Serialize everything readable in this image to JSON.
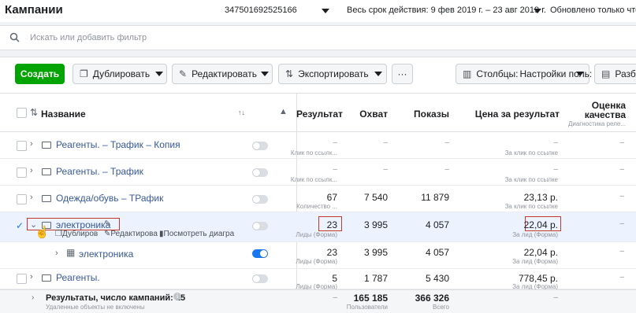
{
  "header": {
    "title": "Кампании",
    "account_id": "347501692525166",
    "date_range": "Весь срок действия: 9 фев 2019 г. – 23 авг 2019 г.",
    "updated": "Обновлено только что"
  },
  "search": {
    "placeholder": "Искать или добавить фильтр"
  },
  "toolbar": {
    "create": "Создать",
    "duplicate": "Дублировать",
    "edit": "Редактировать",
    "export": "Экспортировать",
    "more": "···",
    "columns_prefix": "Столбцы:",
    "columns_value": "Настройки поль:",
    "breakdown": "Разби"
  },
  "table": {
    "headers": {
      "name": "Название",
      "result": "Результат",
      "reach": "Охват",
      "impressions": "Показы",
      "cost": "Цена за результат",
      "quality": "Оценка качества",
      "quality_sub": "Диагностика реле..."
    },
    "rows": [
      {
        "name": "Реагенты. – Трафик – Копия",
        "result": "–",
        "result_sub": "Клик по ссылк...",
        "reach": "–",
        "impressions": "–",
        "cost": "–",
        "cost_sub": "За клик по ссылке",
        "quality": "–"
      },
      {
        "name": "Реагенты. – Трафик",
        "result": "–",
        "result_sub": "Клик по ссылк...",
        "reach": "–",
        "impressions": "–",
        "cost": "–",
        "cost_sub": "За клик по ссылке",
        "quality": "–"
      },
      {
        "name": "Одежда/обувь – ТРафик",
        "result": "67",
        "result_sub": "Количество ...",
        "reach": "7 540",
        "impressions": "11 879",
        "cost": "23,13 р.",
        "cost_sub": "За клик по ссылке",
        "quality": "–"
      },
      {
        "name": "электроника",
        "result": "23",
        "result_sub": "Лиды (Форма)",
        "reach": "3 995",
        "impressions": "4 057",
        "cost": "22,04 р.",
        "cost_sub": "За лид (Форма)",
        "quality": "–",
        "actions": {
          "duplicate": "Дублиров",
          "edit": "Редактирова",
          "view": "Посмотреть диагра"
        }
      },
      {
        "name": "электроника",
        "result": "23",
        "result_sub": "Лиды (Форма)",
        "reach": "3 995",
        "impressions": "4 057",
        "cost": "22,04 р.",
        "cost_sub": "За лид (Форма)",
        "quality": "–"
      },
      {
        "name": "Реагенты.",
        "result": "5",
        "result_sub": "Лиды (Форма)",
        "reach": "1 787",
        "impressions": "5 430",
        "cost": "778,45 р.",
        "cost_sub": "За лид (Форма)",
        "quality": "–"
      }
    ],
    "footer": {
      "label": "Результаты, число кампаний: 15",
      "note": "Удаленные объекты не включены",
      "result": "–",
      "reach": "165 185",
      "reach_sub": "Пользователи",
      "impressions": "366 326",
      "impressions_sub": "Всего",
      "cost": "–"
    }
  },
  "colors": {
    "primary": "#00a400",
    "link": "#385898",
    "toggle_on": "#1877f2",
    "highlight": "#c0392b"
  }
}
